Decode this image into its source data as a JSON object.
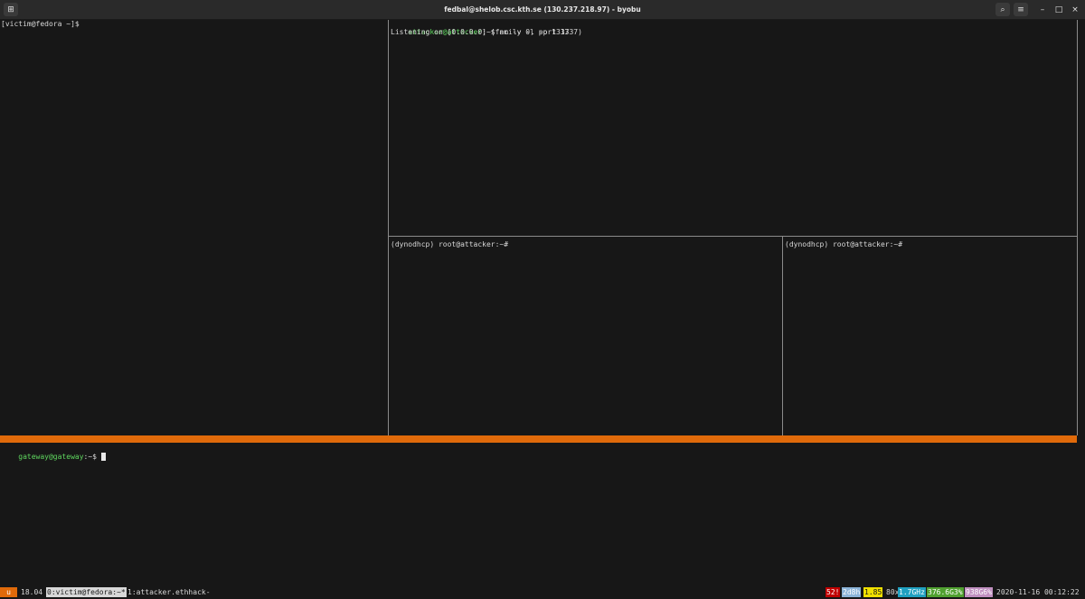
{
  "window": {
    "title": "fedbal@shelob.csc.kth.se (130.237.218.97) - byobu",
    "icons": {
      "new_tab": "new-tab-icon",
      "search": "search-icon",
      "menu": "hamburger-menu-icon",
      "minimize": "minimize-icon",
      "maximize": "maximize-icon",
      "close": "close-icon"
    },
    "glyphs": {
      "new_tab": "⊞",
      "search": "⌕",
      "menu": "≡",
      "minimize": "–",
      "maximize": "□",
      "close": "×"
    }
  },
  "panes": {
    "victim": {
      "prompt": "[victim@fedora ~]$"
    },
    "attacker_nc": {
      "prompt_user": "attacker@attacker",
      "prompt_rest": ":~$ nc -v -l -p 1337",
      "output": "Listening on [0.0.0.0] (family 0, port 1337)"
    },
    "dynodhcp_left": {
      "prompt": "(dynodhcp) root@attacker:~#"
    },
    "dynodhcp_right": {
      "prompt": "(dynodhcp) root@attacker:~#"
    },
    "gateway": {
      "prompt_user": "gateway@gateway",
      "prompt_rest": ":~$ "
    }
  },
  "statusbar": {
    "logo": "u",
    "version": "18.04",
    "window_active": "0:victim@fedora:~*",
    "window_other": "1:attacker.ethhack-",
    "updates": "52!",
    "uptime": "2d8h",
    "load": "1.85",
    "cpu_count": "80x",
    "cpu_freq": "1.7GHz",
    "memory": "376.6G3%",
    "disk": "938G6%",
    "datetime": "2020-11-16 00:12:22"
  },
  "colors": {
    "terminal_bg": "#171717",
    "accent_orange": "#e06a0a",
    "prompt_green": "#5fd75f",
    "updates_bg": "#c00000",
    "uptime_bg": "#8cb4d8",
    "load_bg": "#f0e000",
    "cpu_freq_bg": "#20a0c0",
    "memory_bg": "#50a030",
    "disk_bg": "#c090c0"
  }
}
